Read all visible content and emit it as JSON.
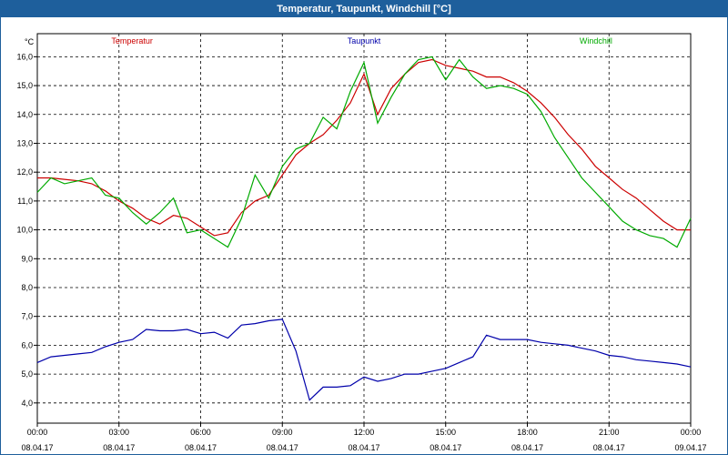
{
  "window": {
    "title": "Temperatur, Taupunkt, Windchill [°C]"
  },
  "chart_data": {
    "type": "line",
    "title": "Temperatur, Taupunkt, Windchill [°C]",
    "ylabel": "°C",
    "ylim": [
      3.3,
      16.8
    ],
    "xlim": [
      0,
      24
    ],
    "grid": true,
    "yticks": [
      4,
      5,
      6,
      7,
      8,
      9,
      10,
      11,
      12,
      13,
      14,
      15,
      16
    ],
    "ytick_labels": [
      "4,0",
      "5,0",
      "6,0",
      "7,0",
      "8,0",
      "9,0",
      "10,0",
      "11,0",
      "12,0",
      "13,0",
      "14,0",
      "15,0",
      "16,0"
    ],
    "xticks": [
      {
        "hour": 0,
        "time": "00:00",
        "date": "08.04.17"
      },
      {
        "hour": 3,
        "time": "03:00",
        "date": "08.04.17"
      },
      {
        "hour": 6,
        "time": "06:00",
        "date": "08.04.17"
      },
      {
        "hour": 9,
        "time": "09:00",
        "date": "08.04.17"
      },
      {
        "hour": 12,
        "time": "12:00",
        "date": "08.04.17"
      },
      {
        "hour": 15,
        "time": "15:00",
        "date": "08.04.17"
      },
      {
        "hour": 18,
        "time": "18:00",
        "date": "08.04.17"
      },
      {
        "hour": 21,
        "time": "21:00",
        "date": "08.04.17"
      },
      {
        "hour": 24,
        "time": "00:00",
        "date": "09.04.17"
      }
    ],
    "legend_placement": "top",
    "series": [
      {
        "name": "Temperatur",
        "color": "#cc0000",
        "x": [
          0,
          0.5,
          1,
          1.5,
          2,
          2.5,
          3,
          3.5,
          4,
          4.5,
          5,
          5.5,
          6,
          6.5,
          7,
          7.5,
          8,
          8.5,
          9,
          9.5,
          10,
          10.5,
          11,
          11.5,
          12,
          12.5,
          13,
          13.5,
          14,
          14.5,
          15,
          15.5,
          16,
          16.5,
          17,
          17.5,
          18,
          18.5,
          19,
          19.5,
          20,
          20.5,
          21,
          21.5,
          22,
          22.5,
          23,
          23.5,
          24
        ],
        "y": [
          11.8,
          11.8,
          11.75,
          11.7,
          11.6,
          11.35,
          11.0,
          10.75,
          10.4,
          10.2,
          10.5,
          10.4,
          10.1,
          9.8,
          9.9,
          10.6,
          11.0,
          11.2,
          11.9,
          12.6,
          13.0,
          13.3,
          13.8,
          14.4,
          15.4,
          14.0,
          14.9,
          15.4,
          15.8,
          15.9,
          15.7,
          15.6,
          15.5,
          15.3,
          15.3,
          15.1,
          14.8,
          14.4,
          13.9,
          13.3,
          12.8,
          12.2,
          11.8,
          11.4,
          11.1,
          10.7,
          10.3,
          10.0,
          10.0
        ]
      },
      {
        "name": "Taupunkt",
        "color": "#0000aa",
        "x": [
          0,
          0.5,
          1,
          1.5,
          2,
          2.5,
          3,
          3.5,
          4,
          4.5,
          5,
          5.5,
          6,
          6.5,
          7,
          7.5,
          8,
          8.5,
          9,
          9.5,
          10,
          10.5,
          11,
          11.5,
          12,
          12.5,
          13,
          13.5,
          14,
          14.5,
          15,
          15.5,
          16,
          16.5,
          17,
          17.5,
          18,
          18.5,
          19,
          19.5,
          20,
          20.5,
          21,
          21.5,
          22,
          22.5,
          23,
          23.5,
          24
        ],
        "y": [
          5.4,
          5.6,
          5.65,
          5.7,
          5.75,
          5.95,
          6.1,
          6.2,
          6.55,
          6.5,
          6.5,
          6.55,
          6.4,
          6.45,
          6.25,
          6.7,
          6.75,
          6.85,
          6.9,
          5.8,
          4.1,
          4.55,
          4.55,
          4.6,
          4.9,
          4.75,
          4.85,
          5.0,
          5.0,
          5.1,
          5.2,
          5.4,
          5.6,
          6.35,
          6.2,
          6.2,
          6.2,
          6.1,
          6.05,
          6.0,
          5.9,
          5.8,
          5.65,
          5.6,
          5.5,
          5.45,
          5.4,
          5.35,
          5.25
        ]
      },
      {
        "name": "Windchill",
        "color": "#00aa00",
        "x": [
          0,
          0.5,
          1,
          1.5,
          2,
          2.5,
          3,
          3.5,
          4,
          4.5,
          5,
          5.5,
          6,
          6.5,
          7,
          7.5,
          8,
          8.5,
          9,
          9.5,
          10,
          10.5,
          11,
          11.5,
          12,
          12.5,
          13,
          13.5,
          14,
          14.5,
          15,
          15.5,
          16,
          16.5,
          17,
          17.5,
          18,
          18.5,
          19,
          19.5,
          20,
          20.5,
          21,
          21.5,
          22,
          22.5,
          23,
          23.5,
          24
        ],
        "y": [
          11.3,
          11.8,
          11.6,
          11.7,
          11.8,
          11.2,
          11.1,
          10.6,
          10.2,
          10.6,
          11.1,
          9.9,
          10.0,
          9.7,
          9.4,
          10.4,
          11.9,
          11.1,
          12.2,
          12.8,
          13.0,
          13.9,
          13.5,
          14.8,
          15.8,
          13.7,
          14.6,
          15.4,
          15.9,
          16.0,
          15.2,
          15.9,
          15.3,
          14.9,
          15.0,
          14.9,
          14.7,
          14.1,
          13.2,
          12.5,
          11.8,
          11.3,
          10.8,
          10.3,
          10.0,
          9.8,
          9.7,
          9.4,
          10.4
        ]
      }
    ]
  }
}
